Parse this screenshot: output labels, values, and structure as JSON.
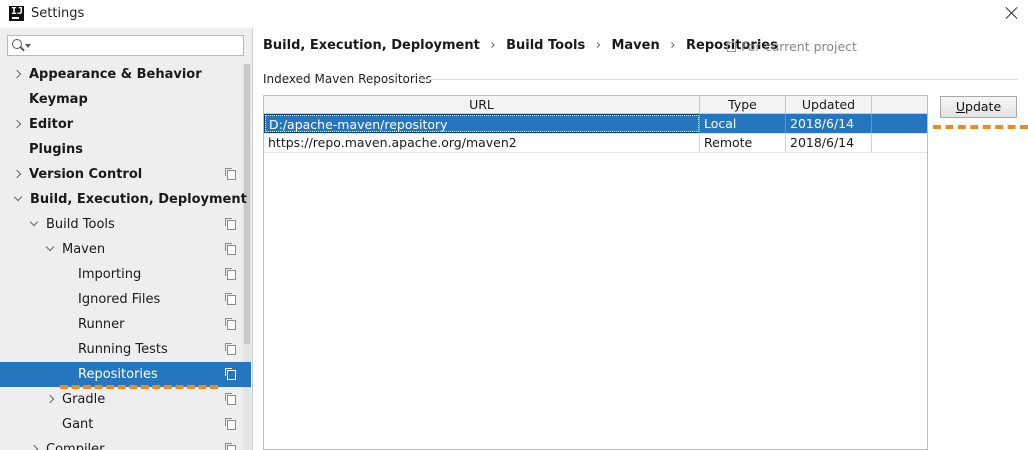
{
  "window": {
    "title": "Settings"
  },
  "search": {
    "placeholder": ""
  },
  "sidebar": {
    "items": [
      {
        "label": "Appearance & Behavior",
        "bold": true,
        "arrow": "right",
        "project_icon": false
      },
      {
        "label": "Keymap",
        "bold": true,
        "arrow": "",
        "project_icon": false
      },
      {
        "label": "Editor",
        "bold": true,
        "arrow": "right",
        "project_icon": false
      },
      {
        "label": "Plugins",
        "bold": true,
        "arrow": "",
        "project_icon": false
      },
      {
        "label": "Version Control",
        "bold": true,
        "arrow": "right",
        "project_icon": true
      },
      {
        "label": "Build, Execution, Deployment",
        "bold": true,
        "arrow": "down",
        "project_icon": false
      },
      {
        "label": "Build Tools",
        "bold": false,
        "arrow": "down",
        "project_icon": true
      },
      {
        "label": "Maven",
        "bold": false,
        "arrow": "down",
        "project_icon": true
      },
      {
        "label": "Importing",
        "bold": false,
        "arrow": "",
        "project_icon": true
      },
      {
        "label": "Ignored Files",
        "bold": false,
        "arrow": "",
        "project_icon": true
      },
      {
        "label": "Runner",
        "bold": false,
        "arrow": "",
        "project_icon": true
      },
      {
        "label": "Running Tests",
        "bold": false,
        "arrow": "",
        "project_icon": true
      },
      {
        "label": "Repositories",
        "bold": false,
        "arrow": "",
        "project_icon": true,
        "selected": true
      },
      {
        "label": "Gradle",
        "bold": false,
        "arrow": "right",
        "project_icon": true
      },
      {
        "label": "Gant",
        "bold": false,
        "arrow": "",
        "project_icon": true
      },
      {
        "label": "Compiler",
        "bold": false,
        "arrow": "right",
        "project_icon": true
      }
    ]
  },
  "breadcrumb": {
    "items": [
      "Build, Execution, Deployment",
      "Build Tools",
      "Maven",
      "Repositories"
    ],
    "separator": "›"
  },
  "for_project": "For current project",
  "section": {
    "label": "Indexed Maven Repositories"
  },
  "table": {
    "columns": [
      "URL",
      "Type",
      "Updated"
    ],
    "rows": [
      {
        "url": "D:/apache-maven/repository",
        "type": "Local",
        "updated": "2018/6/14",
        "selected": true
      },
      {
        "url": "https://repo.maven.apache.org/maven2",
        "type": "Remote",
        "updated": "2018/6/14",
        "selected": false
      }
    ]
  },
  "buttons": {
    "update_mnemonic": "U",
    "update_rest": "pdate"
  },
  "colors": {
    "selection": "#2675bf",
    "annotation": "#f08a1d"
  },
  "icons": {
    "app": "intellij-icon",
    "close": "close-icon",
    "search": "search-icon",
    "project": "project-scope-icon"
  }
}
